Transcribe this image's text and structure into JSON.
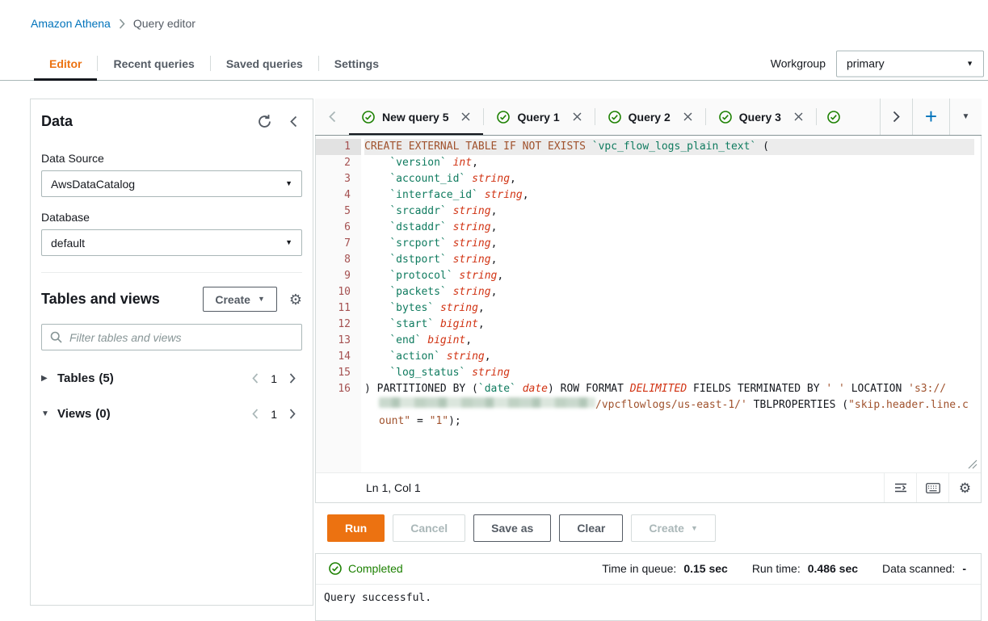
{
  "icons": {
    "add": "+",
    "caret_down": "▼",
    "triangle_right": "▶",
    "triangle_down": "▼",
    "gear": "⚙"
  },
  "breadcrumb": {
    "root": "Amazon Athena",
    "current": "Query editor"
  },
  "nav_tabs": [
    {
      "label": "Editor"
    },
    {
      "label": "Recent queries"
    },
    {
      "label": "Saved queries"
    },
    {
      "label": "Settings"
    }
  ],
  "workgroup": {
    "label": "Workgroup",
    "value": "primary"
  },
  "data_panel": {
    "title": "Data",
    "data_source_label": "Data Source",
    "data_source_value": "AwsDataCatalog",
    "database_label": "Database",
    "database_value": "default",
    "tables_views_title": "Tables and views",
    "create_label": "Create",
    "filter_placeholder": "Filter tables and views",
    "tables": {
      "label": "Tables",
      "count": "(5)",
      "page": "1"
    },
    "views": {
      "label": "Views",
      "count": "(0)",
      "page": "1"
    }
  },
  "query_tabs": [
    {
      "label": "New query 5"
    },
    {
      "label": "Query 1"
    },
    {
      "label": "Query 2"
    },
    {
      "label": "Query 3"
    }
  ],
  "editor": {
    "cursor_position": "Ln 1, Col 1",
    "lines": [
      [
        [
          "kw",
          "CREATE EXTERNAL TABLE IF NOT EXISTS"
        ],
        [
          "pl",
          " "
        ],
        [
          "id",
          "`vpc_flow_logs_plain_text`"
        ],
        [
          "pl",
          " ("
        ]
      ],
      [
        [
          "pl",
          "    "
        ],
        [
          "id",
          "`version`"
        ],
        [
          "pl",
          " "
        ],
        [
          "ty",
          "int"
        ],
        [
          "pl",
          ","
        ]
      ],
      [
        [
          "pl",
          "    "
        ],
        [
          "id",
          "`account_id`"
        ],
        [
          "pl",
          " "
        ],
        [
          "ty",
          "string"
        ],
        [
          "pl",
          ","
        ]
      ],
      [
        [
          "pl",
          "    "
        ],
        [
          "id",
          "`interface_id`"
        ],
        [
          "pl",
          " "
        ],
        [
          "ty",
          "string"
        ],
        [
          "pl",
          ","
        ]
      ],
      [
        [
          "pl",
          "    "
        ],
        [
          "id",
          "`srcaddr`"
        ],
        [
          "pl",
          " "
        ],
        [
          "ty",
          "string"
        ],
        [
          "pl",
          ","
        ]
      ],
      [
        [
          "pl",
          "    "
        ],
        [
          "id",
          "`dstaddr`"
        ],
        [
          "pl",
          " "
        ],
        [
          "ty",
          "string"
        ],
        [
          "pl",
          ","
        ]
      ],
      [
        [
          "pl",
          "    "
        ],
        [
          "id",
          "`srcport`"
        ],
        [
          "pl",
          " "
        ],
        [
          "ty",
          "string"
        ],
        [
          "pl",
          ","
        ]
      ],
      [
        [
          "pl",
          "    "
        ],
        [
          "id",
          "`dstport`"
        ],
        [
          "pl",
          " "
        ],
        [
          "ty",
          "string"
        ],
        [
          "pl",
          ","
        ]
      ],
      [
        [
          "pl",
          "    "
        ],
        [
          "id",
          "`protocol`"
        ],
        [
          "pl",
          " "
        ],
        [
          "ty",
          "string"
        ],
        [
          "pl",
          ","
        ]
      ],
      [
        [
          "pl",
          "    "
        ],
        [
          "id",
          "`packets`"
        ],
        [
          "pl",
          " "
        ],
        [
          "ty",
          "string"
        ],
        [
          "pl",
          ","
        ]
      ],
      [
        [
          "pl",
          "    "
        ],
        [
          "id",
          "`bytes`"
        ],
        [
          "pl",
          " "
        ],
        [
          "ty",
          "string"
        ],
        [
          "pl",
          ","
        ]
      ],
      [
        [
          "pl",
          "    "
        ],
        [
          "id",
          "`start`"
        ],
        [
          "pl",
          " "
        ],
        [
          "ty",
          "bigint"
        ],
        [
          "pl",
          ","
        ]
      ],
      [
        [
          "pl",
          "    "
        ],
        [
          "id",
          "`end`"
        ],
        [
          "pl",
          " "
        ],
        [
          "ty",
          "bigint"
        ],
        [
          "pl",
          ","
        ]
      ],
      [
        [
          "pl",
          "    "
        ],
        [
          "id",
          "`action`"
        ],
        [
          "pl",
          " "
        ],
        [
          "ty",
          "string"
        ],
        [
          "pl",
          ","
        ]
      ],
      [
        [
          "pl",
          "    "
        ],
        [
          "id",
          "`log_status`"
        ],
        [
          "pl",
          " "
        ],
        [
          "ty",
          "string"
        ]
      ],
      [
        [
          "pl",
          ") PARTITIONED BY ("
        ],
        [
          "id",
          "`date`"
        ],
        [
          "pl",
          " "
        ],
        [
          "ty",
          "date"
        ],
        [
          "pl",
          ") ROW FORMAT "
        ],
        [
          "ty",
          "DELIMITED"
        ],
        [
          "pl",
          " FIELDS TERMINATED BY "
        ],
        [
          "st",
          "' '"
        ],
        [
          "pl",
          " LOCATION "
        ],
        [
          "st",
          "'s3://"
        ],
        [
          "blur",
          ""
        ],
        [
          "st",
          "/vpcflowlogs/us-east-1/'"
        ],
        [
          "pl",
          " TBLPROPERTIES ("
        ],
        [
          "st",
          "\"skip.header.line.count\""
        ],
        [
          "pl",
          " = "
        ],
        [
          "st",
          "\"1\""
        ],
        [
          "pl",
          ");"
        ]
      ]
    ]
  },
  "actions": {
    "run": "Run",
    "cancel": "Cancel",
    "save_as": "Save as",
    "clear": "Clear",
    "create": "Create"
  },
  "results": {
    "status": "Completed",
    "metrics": [
      {
        "label": "Time in queue:",
        "value": "0.15 sec"
      },
      {
        "label": "Run time:",
        "value": "0.486 sec"
      },
      {
        "label": "Data scanned:",
        "value": "-"
      }
    ],
    "output": "Query successful."
  }
}
